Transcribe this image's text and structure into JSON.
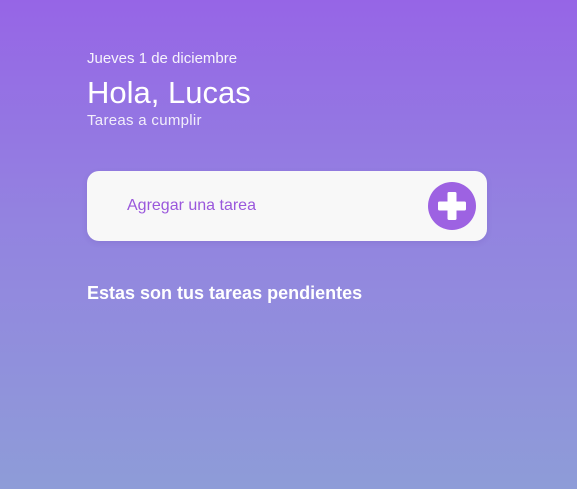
{
  "header": {
    "date": "Jueves 1 de diciembre",
    "greeting": "Hola, Lucas",
    "subtitle": "Tareas a cumplir"
  },
  "add_task": {
    "placeholder": "Agregar una tarea",
    "button_icon": "plus-icon"
  },
  "pending": {
    "title": "Estas son tus tareas pendientes",
    "items": []
  },
  "colors": {
    "accent": "#9d62e2",
    "card_background": "#f8f8f8",
    "gradient_top": "#9665e6",
    "gradient_bottom": "#8e9cd8"
  }
}
